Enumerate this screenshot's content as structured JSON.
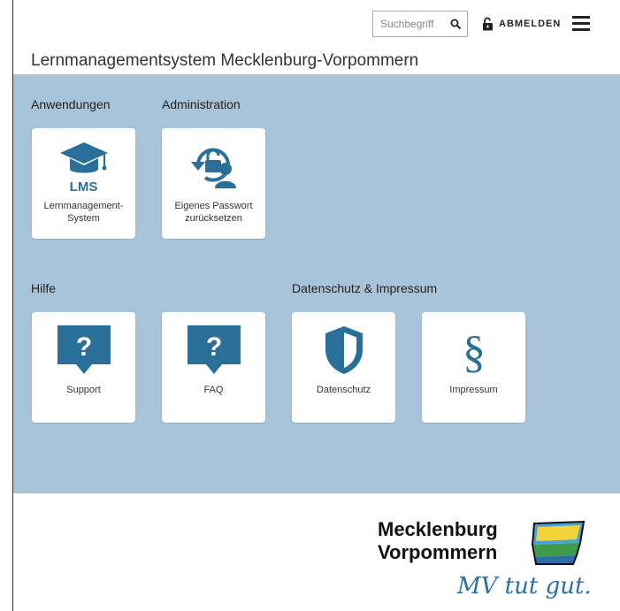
{
  "header": {
    "search_placeholder": "Suchbegriff",
    "logout_label": "ABMELDEN",
    "app_title": "Lernmanagementsystem Mecklenburg-Vorpommern"
  },
  "sections": {
    "anwendungen": "Anwendungen",
    "administration": "Administration",
    "hilfe": "Hilfe",
    "datenschutz": "Datenschutz & Impressum"
  },
  "tiles": {
    "lms": {
      "badge": "LMS",
      "line1": "Lernmanagement-",
      "line2": "System",
      "icon": "graduation-cap-icon"
    },
    "password": {
      "line1": "Eigenes Passwort",
      "line2": "zurücksetzen",
      "icon": "password-reset-icon"
    },
    "support": {
      "label": "Support",
      "icon": "question-speech-bubble-icon"
    },
    "faq": {
      "label": "FAQ",
      "icon": "question-speech-bubble-icon"
    },
    "datenschutz": {
      "label": "Datenschutz",
      "icon": "shield-icon"
    },
    "impressum": {
      "label": "Impressum",
      "icon": "paragraph-icon"
    }
  },
  "footer": {
    "logo_line1": "Mecklenburg",
    "logo_line2": "Vorpommern",
    "slogan": "MV tut gut."
  },
  "colors": {
    "panel": "#a9c3d8",
    "icon_blue": "#2a6f98"
  }
}
